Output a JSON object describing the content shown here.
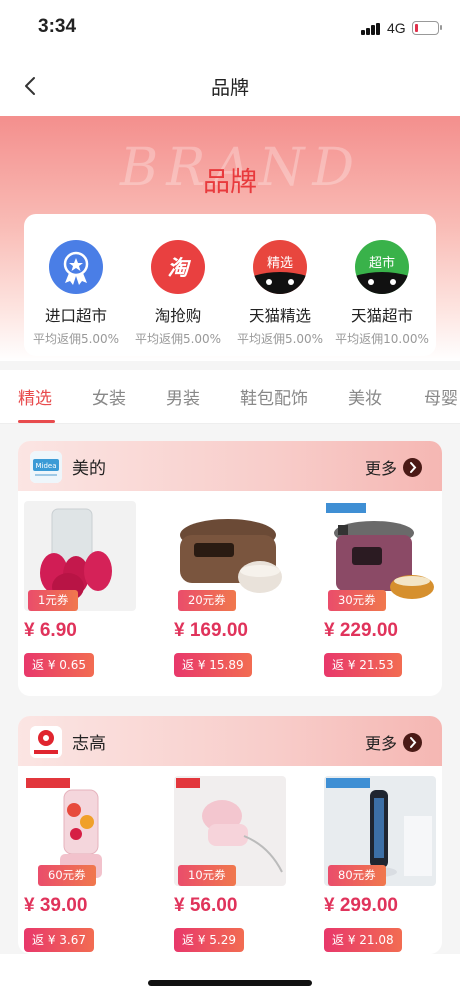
{
  "status": {
    "time": "3:34",
    "network": "4G",
    "battery_level": 0.12,
    "battery_color": "#e0314b"
  },
  "nav": {
    "title": "品牌",
    "back_icon": "chevron-left-icon"
  },
  "hero": {
    "watermark": "BRAND",
    "title": "品牌"
  },
  "categories": [
    {
      "name": "进口超市",
      "rate": "平均返佣5.00%",
      "icon": "ribbon-medal-icon",
      "color": "#4a7ee6",
      "badge": ""
    },
    {
      "name": "淘抢购",
      "rate": "平均返佣5.00%",
      "icon": "tao-icon",
      "color": "#e94040",
      "badge": "淘"
    },
    {
      "name": "天猫精选",
      "rate": "平均返佣5.00%",
      "icon": "tmall-select-icon",
      "color": "#e8463e",
      "badge": "精选"
    },
    {
      "name": "天猫超市",
      "rate": "平均返佣10.00%",
      "icon": "tmall-supermarket-icon",
      "color": "#39b24a",
      "badge": "超市"
    }
  ],
  "tabs": [
    {
      "label": "精选",
      "active": true
    },
    {
      "label": "女装",
      "active": false
    },
    {
      "label": "男装",
      "active": false
    },
    {
      "label": "鞋包配饰",
      "active": false
    },
    {
      "label": "美妆",
      "active": false
    },
    {
      "label": "母婴",
      "active": false
    }
  ],
  "brands": [
    {
      "name": "美的",
      "more": "更多",
      "logo": "midea-logo",
      "products": [
        {
          "coupon": "1元券",
          "price": "¥ 6.90",
          "rebate": "返 ¥ 0.65",
          "image": "makeup-sponge-set"
        },
        {
          "coupon": "20元券",
          "price": "¥ 169.00",
          "rebate": "返 ¥ 15.89",
          "image": "rice-cooker"
        },
        {
          "coupon": "30元券",
          "price": "¥ 229.00",
          "rebate": "返 ¥ 21.53",
          "image": "pressure-cooker"
        }
      ]
    },
    {
      "name": "志高",
      "more": "更多",
      "logo": "chigo-logo",
      "products": [
        {
          "coupon": "60元券",
          "price": "¥ 39.00",
          "rebate": "返 ¥ 3.67",
          "image": "portable-juicer"
        },
        {
          "coupon": "10元券",
          "price": "¥ 56.00",
          "rebate": "返 ¥ 5.29",
          "image": "garment-steamer"
        },
        {
          "coupon": "80元券",
          "price": "¥ 299.00",
          "rebate": "返 ¥ 21.08",
          "image": "tower-fan"
        }
      ]
    }
  ]
}
